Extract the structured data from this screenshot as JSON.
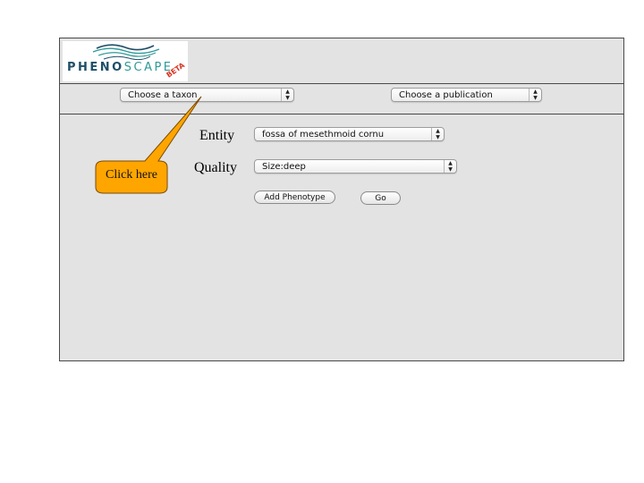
{
  "logo": {
    "word_dark": "PHENO",
    "word_light": "SCAPE",
    "badge": "BETA",
    "colors": {
      "dark": "#1f4f68",
      "teal": "#2d9a98",
      "beta": "#d93320"
    }
  },
  "toolbar": {
    "taxon_select": {
      "value": "Choose a taxon"
    },
    "publication_select": {
      "value": "Choose a publication"
    }
  },
  "form": {
    "entity": {
      "label": "Entity",
      "value": "fossa of mesethmoid cornu"
    },
    "quality": {
      "label": "Quality",
      "value": "Size:deep"
    },
    "add_button": "Add Phenotype",
    "go_button": "Go"
  },
  "callout": {
    "text": "Click here",
    "color": "#ffa500"
  }
}
